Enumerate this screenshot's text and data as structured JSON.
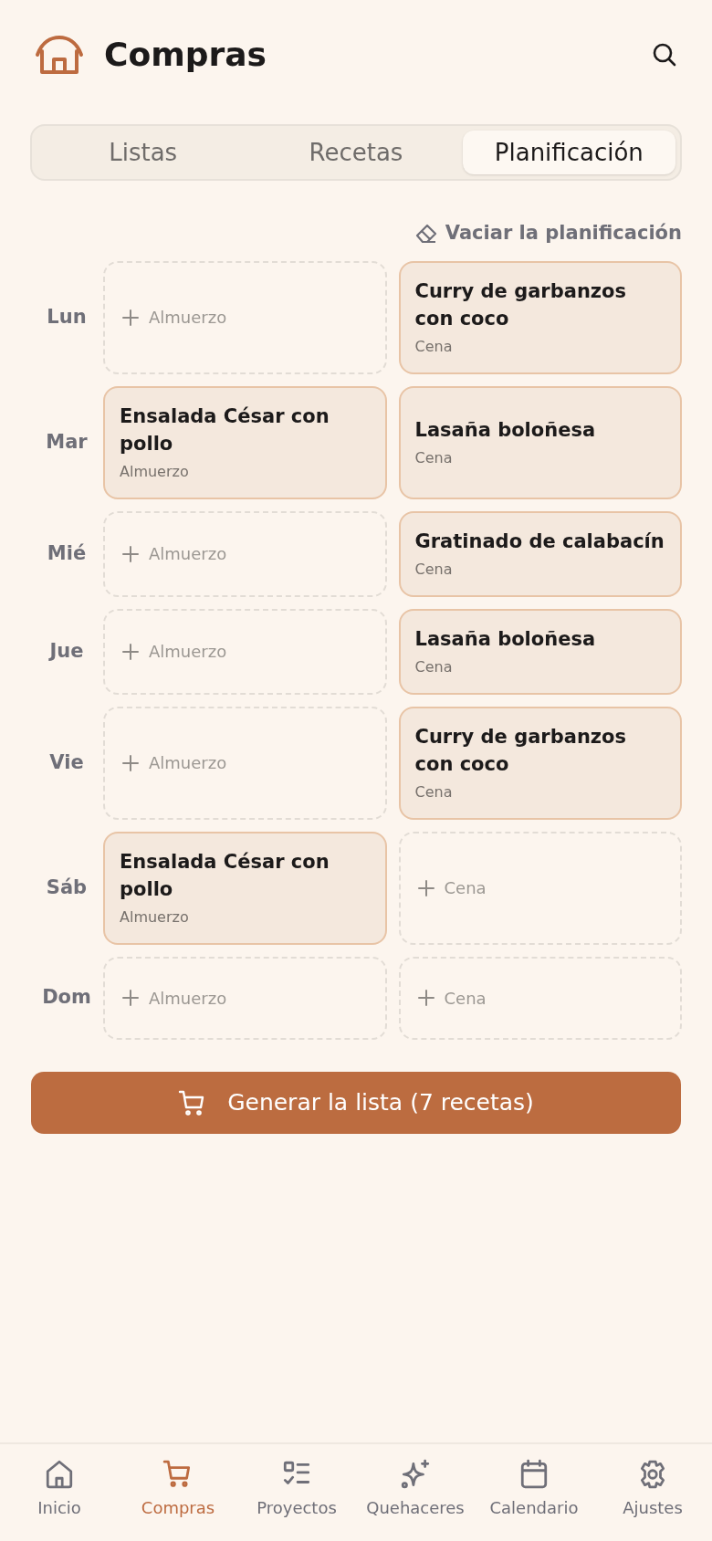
{
  "header": {
    "title": "Compras"
  },
  "tabs": [
    {
      "label": "Listas",
      "selected": false
    },
    {
      "label": "Recetas",
      "selected": false
    },
    {
      "label": "Planificación",
      "selected": true
    }
  ],
  "clear_action": "Vaciar la planificación",
  "days": [
    {
      "label": "Lun",
      "slots": [
        {
          "kind": "empty",
          "label": "Almuerzo"
        },
        {
          "kind": "meal",
          "title": "Curry de garbanzos con coco",
          "meal": "Cena"
        }
      ]
    },
    {
      "label": "Mar",
      "slots": [
        {
          "kind": "meal",
          "title": "Ensalada César con pollo",
          "meal": "Almuerzo"
        },
        {
          "kind": "meal",
          "title": "Lasaña boloñesa",
          "meal": "Cena"
        }
      ]
    },
    {
      "label": "Mié",
      "slots": [
        {
          "kind": "empty",
          "label": "Almuerzo"
        },
        {
          "kind": "meal",
          "title": "Gratinado de calabacín",
          "meal": "Cena"
        }
      ]
    },
    {
      "label": "Jue",
      "slots": [
        {
          "kind": "empty",
          "label": "Almuerzo"
        },
        {
          "kind": "meal",
          "title": "Lasaña boloñesa",
          "meal": "Cena"
        }
      ]
    },
    {
      "label": "Vie",
      "slots": [
        {
          "kind": "empty",
          "label": "Almuerzo"
        },
        {
          "kind": "meal",
          "title": "Curry de garbanzos con coco",
          "meal": "Cena"
        }
      ]
    },
    {
      "label": "Sáb",
      "slots": [
        {
          "kind": "meal",
          "title": "Ensalada César con pollo",
          "meal": "Almuerzo"
        },
        {
          "kind": "empty",
          "label": "Cena"
        }
      ]
    },
    {
      "label": "Dom",
      "slots": [
        {
          "kind": "empty",
          "label": "Almuerzo"
        },
        {
          "kind": "empty",
          "label": "Cena"
        }
      ]
    }
  ],
  "generate_button": "Generar la lista (7 recetas)",
  "nav": [
    {
      "kind": "home",
      "label": "Inicio",
      "selected": false
    },
    {
      "kind": "cart",
      "label": "Compras",
      "selected": true
    },
    {
      "kind": "checklist",
      "label": "Proyectos",
      "selected": false
    },
    {
      "kind": "sparkle",
      "label": "Quehaceres",
      "selected": false
    },
    {
      "kind": "calendar",
      "label": "Calendario",
      "selected": false
    },
    {
      "kind": "gear",
      "label": "Ajustes",
      "selected": false
    }
  ]
}
